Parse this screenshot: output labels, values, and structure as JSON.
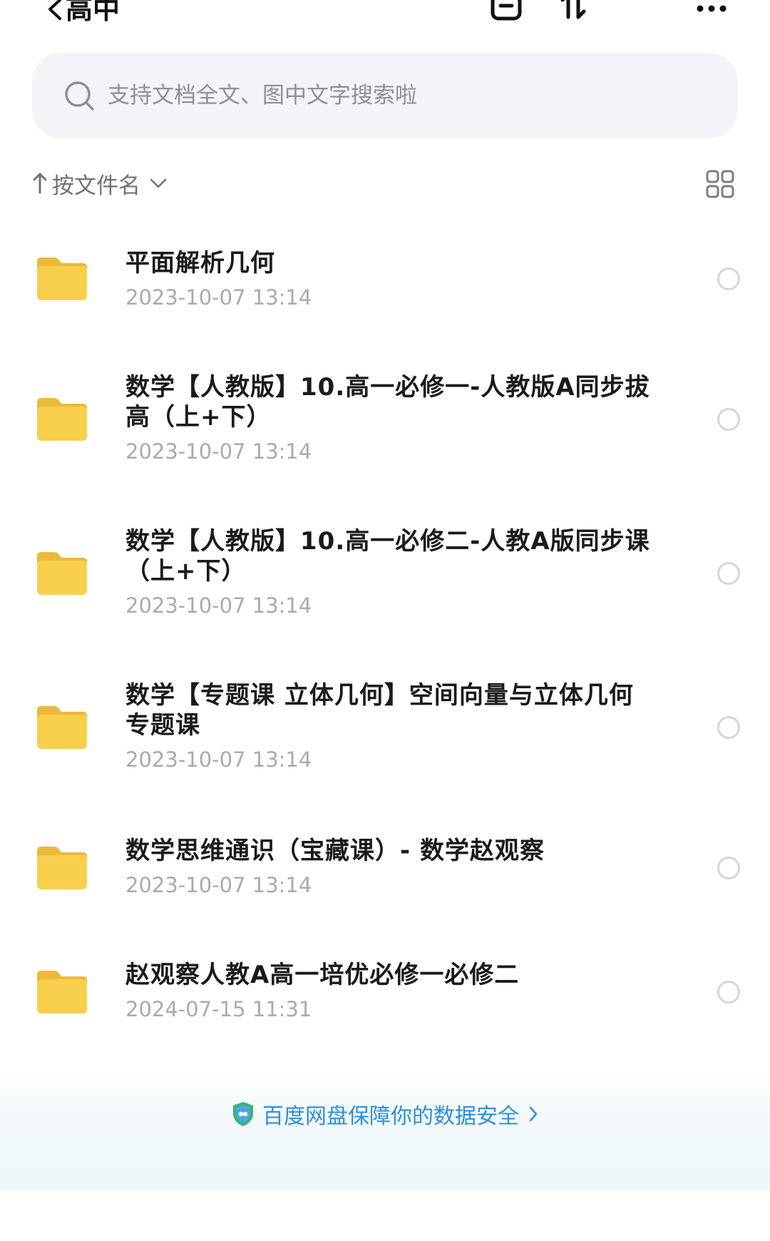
{
  "header": {
    "title": "高中",
    "back_icon": "back-chevron-icon",
    "actions": [
      "scan-icon",
      "sort-transfer-icon",
      "more-icon"
    ]
  },
  "search": {
    "placeholder": "支持文档全文、图中文字搜索啦",
    "value": ""
  },
  "sort": {
    "label": "按文件名",
    "direction_icon": "arrow-up-icon",
    "dropdown_icon": "chevron-down-icon",
    "view_toggle_icon": "grid-view-icon"
  },
  "files": [
    {
      "name": "平面解析几何",
      "date": "2023-10-07 13:14",
      "type": "folder"
    },
    {
      "name": "数学【人教版】10.高一必修一-人教版A同步拔高（上+下）",
      "date": "2023-10-07 13:14",
      "type": "folder"
    },
    {
      "name": "数学【人教版】10.高一必修二-人教A版同步课（上+下）",
      "date": "2023-10-07 13:14",
      "type": "folder"
    },
    {
      "name": "数学【专题课 立体几何】空间向量与立体几何专题课",
      "date": "2023-10-07 13:14",
      "type": "folder"
    },
    {
      "name": "数学思维通识（宝藏课）- 数学赵观察",
      "date": "2023-10-07 13:14",
      "type": "folder"
    },
    {
      "name": "赵观察人教A高一培优必修一必修二",
      "date": "2024-07-15 11:31",
      "type": "folder"
    }
  ],
  "footer": {
    "security_text": "百度网盘保障你的数据安全",
    "shield_icon": "shield-icon"
  },
  "colors": {
    "folder": "#F7CF4C",
    "accent_link": "#2E8FD8",
    "search_bg": "#F3F4F8"
  }
}
